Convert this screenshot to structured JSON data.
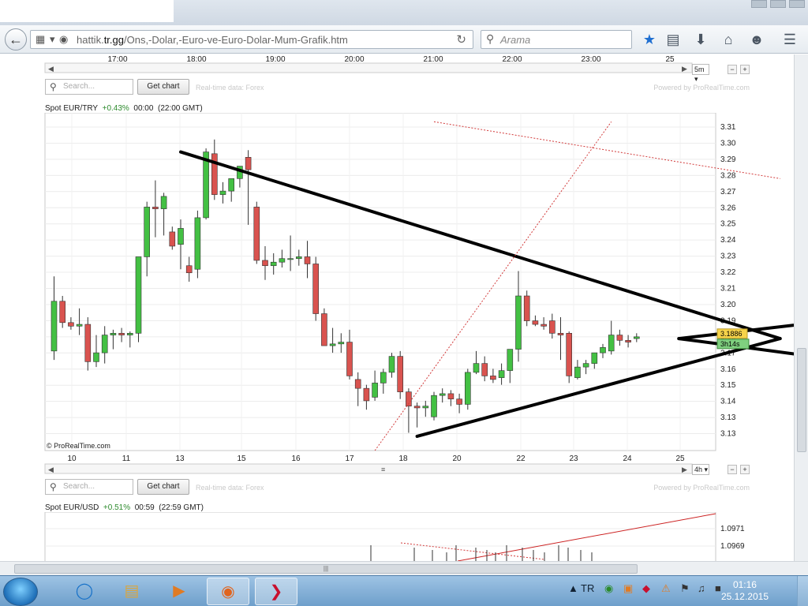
{
  "browser": {
    "url_domain": "hattik.",
    "url_bold": "tr.gg",
    "url_path": "/Ons,-Dolar,-Euro-ve-Euro-Dolar-Mum-Grafik.htm",
    "search_placeholder": "Arama"
  },
  "top_chart": {
    "time_ticks": [
      "17:00",
      "18:00",
      "19:00",
      "20:00",
      "21:00",
      "22:00",
      "23:00",
      "25"
    ],
    "interval": "5m",
    "search_placeholder": "Search...",
    "get_chart_label": "Get chart",
    "realtime_label": "Real-time data: Forex",
    "powered_label": "Powered by ProRealTime.com"
  },
  "main_chart": {
    "instrument": "Spot EUR/TRY",
    "change": "+0.43%",
    "time": "00:00",
    "gmt": "(22:00 GMT)",
    "copyright": "© ProRealTime.com",
    "interval": "4h",
    "price_tag": "3.1886",
    "countdown_tag": "3h14s"
  },
  "chart_data": [
    {
      "type": "candlestick",
      "title": "Spot EUR/TRY",
      "x_tick_labels": [
        "10",
        "11",
        "13",
        "15",
        "16",
        "17",
        "18",
        "20",
        "22",
        "23",
        "24",
        "25"
      ],
      "y_tick_labels": [
        "3.31",
        "3.30",
        "3.29",
        "3.28",
        "3.27",
        "3.26",
        "3.25",
        "3.24",
        "3.23",
        "3.22",
        "3.21",
        "3.20",
        "3.19",
        "3.18",
        "3.17",
        "3.16",
        "3.15",
        "3.14",
        "3.13",
        "3.13"
      ],
      "ylim": [
        3.125,
        3.315
      ],
      "grid": true,
      "candles": [
        {
          "o": 3.181,
          "h": 3.223,
          "l": 3.176,
          "c": 3.209
        },
        {
          "o": 3.209,
          "h": 3.212,
          "l": 3.194,
          "c": 3.197
        },
        {
          "o": 3.197,
          "h": 3.2,
          "l": 3.193,
          "c": 3.195
        },
        {
          "o": 3.195,
          "h": 3.205,
          "l": 3.19,
          "c": 3.196
        },
        {
          "o": 3.196,
          "h": 3.2,
          "l": 3.17,
          "c": 3.175
        },
        {
          "o": 3.175,
          "h": 3.19,
          "l": 3.172,
          "c": 3.18
        },
        {
          "o": 3.18,
          "h": 3.195,
          "l": 3.174,
          "c": 3.19
        },
        {
          "o": 3.19,
          "h": 3.193,
          "l": 3.182,
          "c": 3.191
        },
        {
          "o": 3.191,
          "h": 3.194,
          "l": 3.186,
          "c": 3.19
        },
        {
          "o": 3.19,
          "h": 3.192,
          "l": 3.183,
          "c": 3.191
        },
        {
          "o": 3.191,
          "h": 3.228,
          "l": 3.186,
          "c": 3.234
        },
        {
          "o": 3.234,
          "h": 3.265,
          "l": 3.223,
          "c": 3.262
        },
        {
          "o": 3.262,
          "h": 3.277,
          "l": 3.245,
          "c": 3.261
        },
        {
          "o": 3.261,
          "h": 3.27,
          "l": 3.246,
          "c": 3.268
        },
        {
          "o": 3.248,
          "h": 3.251,
          "l": 3.238,
          "c": 3.24
        },
        {
          "o": 3.241,
          "h": 3.255,
          "l": 3.227,
          "c": 3.25
        },
        {
          "o": 3.229,
          "h": 3.234,
          "l": 3.22,
          "c": 3.225
        },
        {
          "o": 3.227,
          "h": 3.26,
          "l": 3.222,
          "c": 3.256
        },
        {
          "o": 3.256,
          "h": 3.295,
          "l": 3.255,
          "c": 3.293
        },
        {
          "o": 3.292,
          "h": 3.3,
          "l": 3.266,
          "c": 3.269
        },
        {
          "o": 3.269,
          "h": 3.276,
          "l": 3.264,
          "c": 3.271
        },
        {
          "o": 3.271,
          "h": 3.277,
          "l": 3.265,
          "c": 3.278
        },
        {
          "o": 3.278,
          "h": 3.284,
          "l": 3.273,
          "c": 3.285
        },
        {
          "o": 3.29,
          "h": 3.294,
          "l": 3.252,
          "c": 3.283
        },
        {
          "o": 3.262,
          "h": 3.265,
          "l": 3.23,
          "c": 3.232
        },
        {
          "o": 3.232,
          "h": 3.24,
          "l": 3.221,
          "c": 3.229
        },
        {
          "o": 3.229,
          "h": 3.236,
          "l": 3.224,
          "c": 3.231
        },
        {
          "o": 3.231,
          "h": 3.238,
          "l": 3.228,
          "c": 3.233
        },
        {
          "o": 3.233,
          "h": 3.246,
          "l": 3.226,
          "c": 3.233
        },
        {
          "o": 3.233,
          "h": 3.238,
          "l": 3.229,
          "c": 3.234
        },
        {
          "o": 3.234,
          "h": 3.243,
          "l": 3.222,
          "c": 3.23
        },
        {
          "o": 3.23,
          "h": 3.234,
          "l": 3.198,
          "c": 3.202
        },
        {
          "o": 3.202,
          "h": 3.205,
          "l": 3.185,
          "c": 3.184
        },
        {
          "o": 3.184,
          "h": 3.194,
          "l": 3.18,
          "c": 3.185
        },
        {
          "o": 3.185,
          "h": 3.191,
          "l": 3.18,
          "c": 3.186
        },
        {
          "o": 3.186,
          "h": 3.193,
          "l": 3.165,
          "c": 3.167
        },
        {
          "o": 3.165,
          "h": 3.169,
          "l": 3.15,
          "c": 3.16
        },
        {
          "o": 3.16,
          "h": 3.162,
          "l": 3.148,
          "c": 3.153
        },
        {
          "o": 3.155,
          "h": 3.17,
          "l": 3.153,
          "c": 3.163
        },
        {
          "o": 3.163,
          "h": 3.171,
          "l": 3.157,
          "c": 3.169
        },
        {
          "o": 3.169,
          "h": 3.18,
          "l": 3.166,
          "c": 3.178
        },
        {
          "o": 3.178,
          "h": 3.181,
          "l": 3.154,
          "c": 3.158
        },
        {
          "o": 3.158,
          "h": 3.16,
          "l": 3.135,
          "c": 3.15
        },
        {
          "o": 3.15,
          "h": 3.152,
          "l": 3.138,
          "c": 3.149
        },
        {
          "o": 3.149,
          "h": 3.153,
          "l": 3.144,
          "c": 3.15
        },
        {
          "o": 3.144,
          "h": 3.158,
          "l": 3.142,
          "c": 3.156
        },
        {
          "o": 3.156,
          "h": 3.16,
          "l": 3.152,
          "c": 3.157
        },
        {
          "o": 3.157,
          "h": 3.159,
          "l": 3.15,
          "c": 3.154
        },
        {
          "o": 3.154,
          "h": 3.157,
          "l": 3.146,
          "c": 3.151
        },
        {
          "o": 3.151,
          "h": 3.171,
          "l": 3.148,
          "c": 3.169
        },
        {
          "o": 3.169,
          "h": 3.181,
          "l": 3.168,
          "c": 3.174
        },
        {
          "o": 3.174,
          "h": 3.178,
          "l": 3.164,
          "c": 3.167
        },
        {
          "o": 3.167,
          "h": 3.171,
          "l": 3.163,
          "c": 3.165
        },
        {
          "o": 3.166,
          "h": 3.174,
          "l": 3.162,
          "c": 3.17
        },
        {
          "o": 3.17,
          "h": 3.178,
          "l": 3.163,
          "c": 3.182
        },
        {
          "o": 3.182,
          "h": 3.226,
          "l": 3.175,
          "c": 3.212
        },
        {
          "o": 3.212,
          "h": 3.215,
          "l": 3.195,
          "c": 3.198
        },
        {
          "o": 3.198,
          "h": 3.201,
          "l": 3.195,
          "c": 3.196
        },
        {
          "o": 3.196,
          "h": 3.2,
          "l": 3.193,
          "c": 3.195
        },
        {
          "o": 3.198,
          "h": 3.202,
          "l": 3.188,
          "c": 3.191
        },
        {
          "o": 3.191,
          "h": 3.2,
          "l": 3.176,
          "c": 3.19
        },
        {
          "o": 3.191,
          "h": 3.192,
          "l": 3.163,
          "c": 3.167
        },
        {
          "o": 3.166,
          "h": 3.176,
          "l": 3.165,
          "c": 3.172
        },
        {
          "o": 3.172,
          "h": 3.176,
          "l": 3.168,
          "c": 3.174
        },
        {
          "o": 3.174,
          "h": 3.18,
          "l": 3.171,
          "c": 3.18
        },
        {
          "o": 3.18,
          "h": 3.185,
          "l": 3.177,
          "c": 3.183
        },
        {
          "o": 3.181,
          "h": 3.198,
          "l": 3.179,
          "c": 3.19
        },
        {
          "o": 3.19,
          "h": 3.193,
          "l": 3.184,
          "c": 3.187
        },
        {
          "o": 3.187,
          "h": 3.19,
          "l": 3.183,
          "c": 3.186
        },
        {
          "o": 3.188,
          "h": 3.191,
          "l": 3.186,
          "c": 3.189
        }
      ],
      "trendlines": [
        {
          "style": "solid",
          "from": [
            15,
            3.293
          ],
          "to": [
            86,
            3.188
          ]
        },
        {
          "style": "solid",
          "from": [
            43,
            3.133
          ],
          "to": [
            86,
            3.188
          ]
        },
        {
          "style": "solid",
          "from": [
            74,
            3.188
          ],
          "to": [
            112,
            3.209
          ]
        },
        {
          "style": "solid",
          "from": [
            74,
            3.188
          ],
          "to": [
            112,
            3.164
          ]
        },
        {
          "style": "dotted",
          "from": [
            38,
            3.125
          ],
          "to": [
            66,
            3.31
          ]
        },
        {
          "style": "dotted",
          "from": [
            45,
            3.31
          ],
          "to": [
            86,
            3.278
          ]
        }
      ]
    },
    {
      "type": "candlestick",
      "title": "Spot EUR/USD",
      "y_tick_labels": [
        "1.0971",
        "1.0969"
      ],
      "grid": true
    }
  ],
  "bottom_chart": {
    "instrument": "Spot EUR/USD",
    "change": "+0.51%",
    "time": "00:59",
    "gmt": "(22:59 GMT)",
    "search_placeholder": "Search...",
    "get_chart_label": "Get chart",
    "realtime_label": "Real-time data: Forex",
    "powered_label": "Powered by ProRealTime.com"
  },
  "taskbar": {
    "lang": "TR",
    "clock_time": "01:16",
    "clock_date": "25.12.2015"
  },
  "colors": {
    "up": "#43c043",
    "down": "#d9534f",
    "price_tag": "#f6d34a",
    "countdown_tag": "#7fd07f"
  }
}
